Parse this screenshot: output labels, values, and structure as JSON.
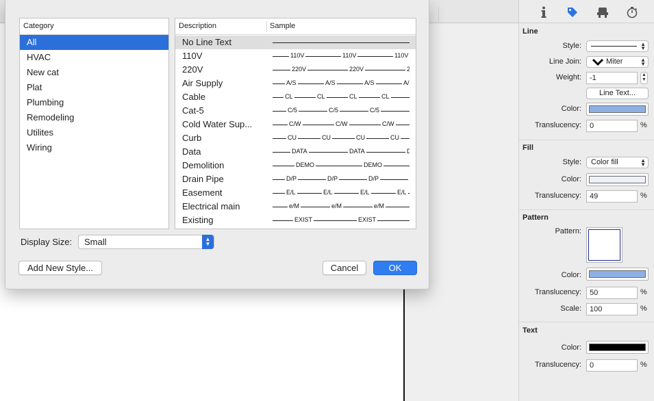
{
  "inspector": {
    "tabs": [
      {
        "icon": "info-icon"
      },
      {
        "icon": "tag-icon"
      },
      {
        "icon": "stamp-icon"
      },
      {
        "icon": "stopwatch-icon"
      }
    ],
    "line": {
      "title": "Line",
      "style_label": "Style:",
      "join_label": "Line Join:",
      "join_value": "Miter",
      "weight_label": "Weight:",
      "weight_value": "-1",
      "line_text_button": "Line Text...",
      "color_label": "Color:",
      "color": "#8fb0e3",
      "translucency_label": "Translucency:",
      "translucency_value": "0",
      "pct": "%"
    },
    "fill": {
      "title": "Fill",
      "style_label": "Style:",
      "style_value": "Color fill",
      "color_label": "Color:",
      "color": "#eef1f7",
      "translucency_label": "Translucency:",
      "translucency_value": "49",
      "pct": "%"
    },
    "pattern": {
      "title": "Pattern",
      "pattern_label": "Pattern:",
      "color_label": "Color:",
      "color": "#8fb0e3",
      "translucency_label": "Translucency:",
      "translucency_value": "50",
      "scale_label": "Scale:",
      "scale_value": "100",
      "pct": "%"
    },
    "text": {
      "title": "Text",
      "color_label": "Color:",
      "color": "#000000",
      "translucency_label": "Translucency:",
      "translucency_value": "0",
      "pct": "%"
    }
  },
  "dialog": {
    "category_header": "Category",
    "categories": [
      "All",
      "HVAC",
      "New cat",
      "Plat",
      "Plumbing",
      "Remodeling",
      "Utilites",
      "Wiring"
    ],
    "selected_category": "All",
    "desc_header": "Description",
    "sample_header": "Sample",
    "styles": [
      {
        "name": "No Line Text",
        "sample": "",
        "spacing": 0,
        "first": 0
      },
      {
        "name": "110V",
        "sample": "110V",
        "spacing": 76,
        "first": 24
      },
      {
        "name": "220V",
        "sample": "220V",
        "spacing": 84,
        "first": 26
      },
      {
        "name": "Air Supply",
        "sample": "A/S",
        "spacing": 57,
        "first": 18
      },
      {
        "name": "Cable",
        "sample": "CL",
        "spacing": 47,
        "first": 16
      },
      {
        "name": "Cat-5",
        "sample": "C/5",
        "spacing": 60,
        "first": 20
      },
      {
        "name": "Cold Water Sup...",
        "sample": "C/W",
        "spacing": 68,
        "first": 22
      },
      {
        "name": "Curb",
        "sample": "CU",
        "spacing": 50,
        "first": 20
      },
      {
        "name": "Data",
        "sample": "DATA",
        "spacing": 84,
        "first": 26
      },
      {
        "name": "Demolition",
        "sample": "DEMO",
        "spacing": 99,
        "first": 32
      },
      {
        "name": "Drain Pipe",
        "sample": "D/P",
        "spacing": 60,
        "first": 18
      },
      {
        "name": "Easement",
        "sample": "E/L",
        "spacing": 54,
        "first": 18
      },
      {
        "name": "Electrical main",
        "sample": "e/M",
        "spacing": 62,
        "first": 22
      },
      {
        "name": "Existing",
        "sample": "EXIST",
        "spacing": 93,
        "first": 30
      }
    ],
    "display_size_label": "Display Size:",
    "display_size_value": "Small",
    "add_button": "Add New Style...",
    "cancel_button": "Cancel",
    "ok_button": "OK"
  }
}
